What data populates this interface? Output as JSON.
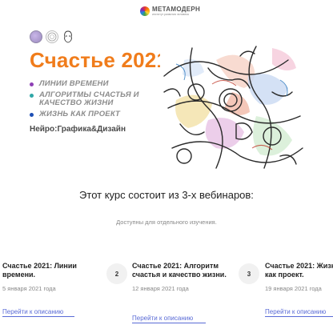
{
  "header": {
    "logo_name": "МЕТАМОДЕРН",
    "logo_tagline": "институт развития человека"
  },
  "hero": {
    "partner_logos": [
      "partner-logo-1",
      "partner-logo-2",
      "partner-logo-3"
    ],
    "title": "Счастье 2021:",
    "topics": [
      {
        "label": "ЛИНИИ ВРЕМЕНИ",
        "color": "#8e3fb5"
      },
      {
        "label": "АЛГОРИТМЫ СЧАСТЬЯ И КАЧЕСТВО ЖИЗНИ",
        "color": "#2fa7a7"
      },
      {
        "label": "ЖИЗНЬ КАК ПРОЕКТ",
        "color": "#1e4fb5"
      }
    ],
    "subtitle": "Нейро:Графика&Дизайн",
    "title_color": "#f07c1b"
  },
  "section": {
    "title": "Этот курс состоит из 3-х вебинаров:",
    "subtitle": "Доступны для отдельного изучения."
  },
  "courses": [
    {
      "number": "",
      "title": "Счастье 2021: Линии времени.",
      "date": "5 января 2021 года",
      "link": "Перейти к описанию"
    },
    {
      "number": "2",
      "title": "Счастье 2021: Алгоритм счастья и качество жизни.",
      "date": "12 января 2021 года",
      "link": "Перейти к описанию"
    },
    {
      "number": "3",
      "title": "Счастье 2021: Жизнь как проект.",
      "date": "19 января 2021 года",
      "link": "Перейти к описанию"
    }
  ],
  "colors": {
    "accent": "#f07c1b",
    "link": "#5a6bd6"
  }
}
